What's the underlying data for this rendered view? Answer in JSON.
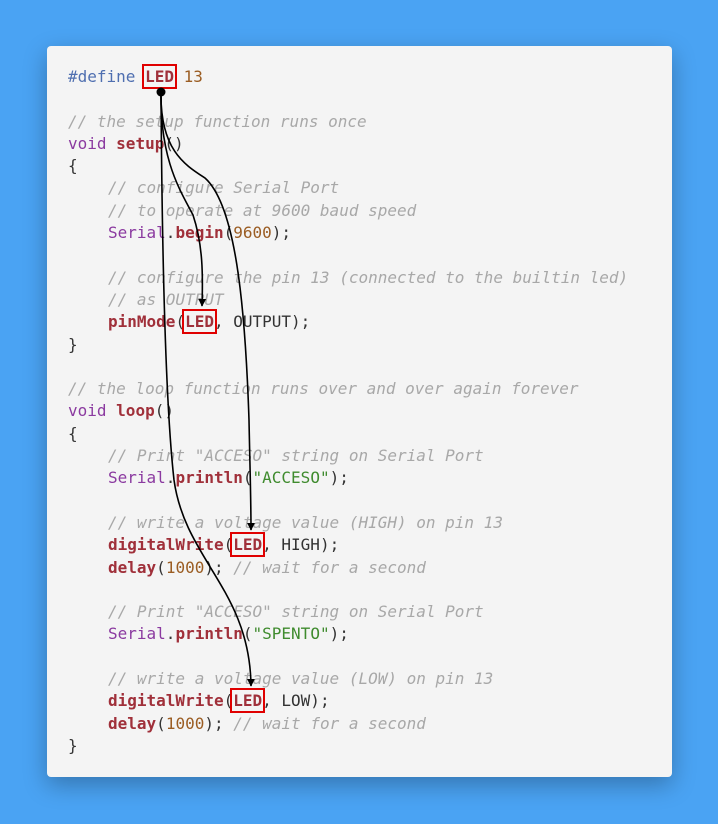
{
  "code": {
    "define_kw": "#define",
    "define_name": "LED",
    "define_value": "13",
    "c_setup": "// the setup function runs once",
    "void1": "void",
    "setup_fn": "setup",
    "setup_paren": "()",
    "open1": "{",
    "c_serial1": "// configure Serial Port",
    "c_serial2": "// to operate at 9600 baud speed",
    "serial1": "Serial",
    "dot1": ".",
    "begin_fn": "begin",
    "begin_open": "(",
    "baud": "9600",
    "begin_close": ");",
    "c_pin1": "// configure the pin 13 (connected to the builtin led)",
    "c_pin2": "// as OUTPUT",
    "pinmode_fn": "pinMode",
    "pinmode_open": "(",
    "pinmode_arg": "LED",
    "pinmode_rest": ", OUTPUT);",
    "close1": "}",
    "c_loop": "// the loop function runs over and over again forever",
    "void2": "void",
    "loop_fn": "loop",
    "loop_paren": "()",
    "open2": "{",
    "c_print1": "// Print \"ACCESO\" string on Serial Port",
    "serial2": "Serial",
    "dot2": ".",
    "println1_fn": "println",
    "println1_open": "(",
    "str_acceso": "\"ACCESO\"",
    "println1_close": ");",
    "c_high": "// write a voltage value (HIGH) on pin 13",
    "dw1_fn": "digitalWrite",
    "dw1_open": "(",
    "dw1_arg": "LED",
    "dw1_rest": ", HIGH);",
    "delay1_fn": "delay",
    "delay1_open": "(",
    "delay1_val": "1000",
    "delay1_close": "); ",
    "c_wait1": "// wait for a second",
    "c_print2": "// Print \"ACCESO\" string on Serial Port",
    "serial3": "Serial",
    "dot3": ".",
    "println2_fn": "println",
    "println2_open": "(",
    "str_spento": "\"SPENTO\"",
    "println2_close": ");",
    "c_low": "// write a voltage value (LOW) on pin 13",
    "dw2_fn": "digitalWrite",
    "dw2_open": "(",
    "dw2_arg": "LED",
    "dw2_rest": ", LOW);",
    "delay2_fn": "delay",
    "delay2_open": "(",
    "delay2_val": "1000",
    "delay2_close": "); ",
    "c_wait2": "// wait for a second",
    "close2": "}"
  },
  "colors": {
    "background": "#4aa3f3",
    "card": "#f4f4f4",
    "highlight_box": "#e00000",
    "arrow": "#000000"
  }
}
